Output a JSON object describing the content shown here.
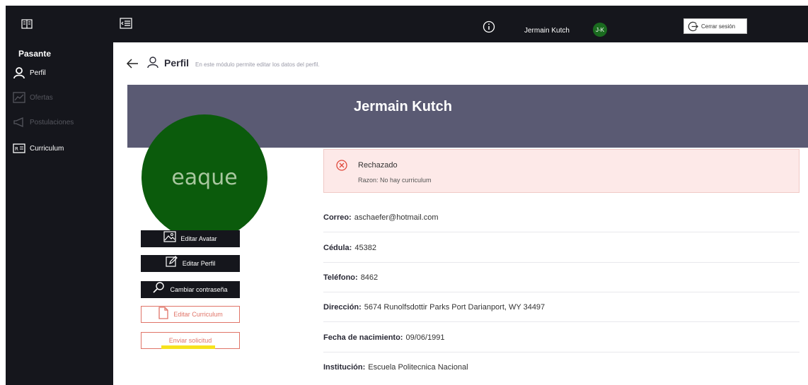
{
  "sidebar": {
    "role": "Pasante",
    "items": [
      {
        "label": "Perfil",
        "icon": "user-icon",
        "state": "active"
      },
      {
        "label": "Ofertas",
        "icon": "chart-icon",
        "state": "disabled"
      },
      {
        "label": "Postulaciones",
        "icon": "megaphone-icon",
        "state": "disabled"
      },
      {
        "label": "Curriculum",
        "icon": "id-card-icon",
        "state": "active"
      }
    ]
  },
  "topbar": {
    "username": "Jermain Kutch",
    "avatar_initials": "J-K",
    "logout_label": "Cerrar sesión"
  },
  "page": {
    "title": "Perfil",
    "subtitle": "En este módulo permite editar los datos del perfil."
  },
  "profile": {
    "name": "Jermain Kutch",
    "avatar_text": "eaque"
  },
  "buttons": {
    "edit_avatar": "Editar Avatar",
    "edit_profile": "Editar Perfil",
    "change_password": "Cambiar contraseña",
    "edit_curriculum": "Editar Curriculum",
    "send_request": "Enviar solicitud"
  },
  "status": {
    "title": "Rechazado",
    "reason": "Razon: No hay curriculum"
  },
  "details": [
    {
      "label": "Correo:",
      "value": "aschaefer@hotmail.com"
    },
    {
      "label": "Cédula:",
      "value": "45382"
    },
    {
      "label": "Teléfono:",
      "value": "8462"
    },
    {
      "label": "Dirección:",
      "value": "5674 Runolfsdottir Parks Port Darianport, WY 34497"
    },
    {
      "label": "Fecha de nacimiento:",
      "value": "09/06/1991"
    },
    {
      "label": "Institución:",
      "value": "Escuela Politecnica Nacional"
    }
  ],
  "colors": {
    "sidebar_bg": "#15161c",
    "banner_bg": "#5a5a73",
    "avatar_bg": "#0b5b0c",
    "danger": "#e07468",
    "status_bg": "#fde9e8",
    "highlight": "#f6e21d"
  }
}
